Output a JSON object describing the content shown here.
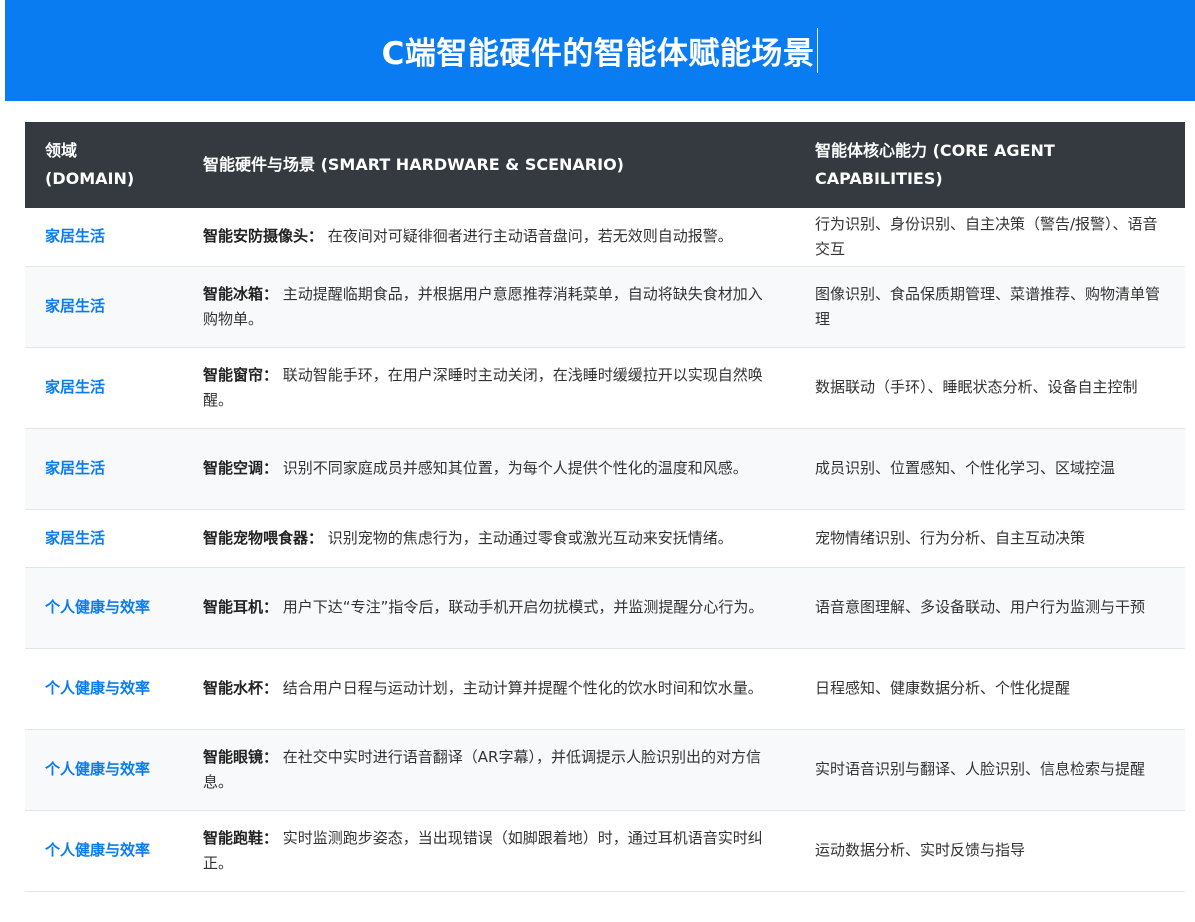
{
  "title": "C端智能硬件的智能体赋能场景",
  "headers": {
    "domain": "领域\n(DOMAIN)",
    "scenario": "智能硬件与场景 (SMART HARDWARE & SCENARIO)",
    "capabilities": "智能体核心能力 (CORE AGENT CAPABILITIES)"
  },
  "rows": [
    {
      "domain": "家居生活",
      "device": "智能安防摄像头：",
      "scenario": "在夜间对可疑徘徊者进行主动语音盘问，若无效则自动报警。",
      "capabilities": "行为识别、身份识别、自主决策（警告/报警）、语音交互"
    },
    {
      "domain": "家居生活",
      "device": "智能冰箱：",
      "scenario": "主动提醒临期食品，并根据用户意愿推荐消耗菜单，自动将缺失食材加入购物单。",
      "capabilities": "图像识别、食品保质期管理、菜谱推荐、购物清单管理"
    },
    {
      "domain": "家居生活",
      "device": "智能窗帘：",
      "scenario": "联动智能手环，在用户深睡时主动关闭，在浅睡时缓缓拉开以实现自然唤醒。",
      "capabilities": "数据联动（手环）、睡眠状态分析、设备自主控制"
    },
    {
      "domain": "家居生活",
      "device": "智能空调：",
      "scenario": "识别不同家庭成员并感知其位置，为每个人提供个性化的温度和风感。",
      "capabilities": "成员识别、位置感知、个性化学习、区域控温"
    },
    {
      "domain": "家居生活",
      "device": "智能宠物喂食器：",
      "scenario": "识别宠物的焦虑行为，主动通过零食或激光互动来安抚情绪。",
      "capabilities": "宠物情绪识别、行为分析、自主互动决策"
    },
    {
      "domain": "个人健康与效率",
      "device": "智能耳机：",
      "scenario": "用户下达“专注”指令后，联动手机开启勿扰模式，并监测提醒分心行为。",
      "capabilities": "语音意图理解、多设备联动、用户行为监测与干预"
    },
    {
      "domain": "个人健康与效率",
      "device": "智能水杯：",
      "scenario": "结合用户日程与运动计划，主动计算并提醒个性化的饮水时间和饮水量。",
      "capabilities": "日程感知、健康数据分析、个性化提醒"
    },
    {
      "domain": "个人健康与效率",
      "device": "智能眼镜：",
      "scenario": "在社交中实时进行语音翻译（AR字幕），并低调提示人脸识别出的对方信息。",
      "capabilities": "实时语音识别与翻译、人脸识别、信息检索与提醒"
    },
    {
      "domain": "个人健康与效率",
      "device": "智能跑鞋：",
      "scenario": "实时监测跑步姿态，当出现错误（如脚跟着地）时，通过耳机语音实时纠正。",
      "capabilities": "运动数据分析、实时反馈与指导"
    }
  ]
}
